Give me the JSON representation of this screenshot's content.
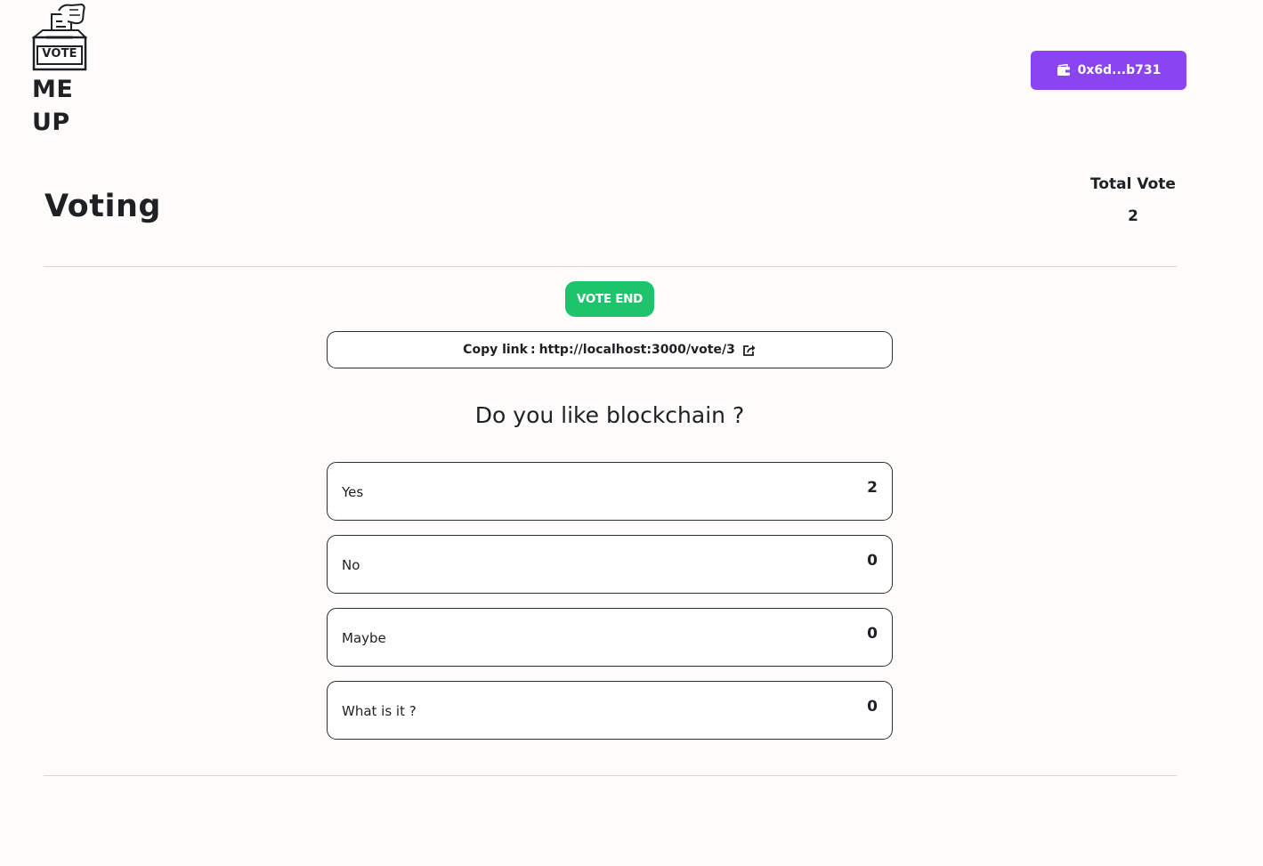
{
  "logo": {
    "box_text": "VOTE",
    "line1": "ME",
    "line2": "UP"
  },
  "wallet": {
    "address": "0x6d...b731",
    "icon": "wallet-icon",
    "color": "#8a44f2"
  },
  "page": {
    "title": "Voting"
  },
  "total": {
    "label": "Total Vote",
    "value": "2"
  },
  "status": {
    "label": "VOTE END",
    "color": "#1dc46b"
  },
  "copy_link": {
    "label": "Copy link",
    "separator": ":",
    "url": "http://localhost:3000/vote/3",
    "icon": "external-link-icon"
  },
  "question": "Do you like blockchain ?",
  "options": [
    {
      "label": "Yes",
      "count": "2"
    },
    {
      "label": "No",
      "count": "0"
    },
    {
      "label": "Maybe",
      "count": "0"
    },
    {
      "label": "What is it ?",
      "count": "0"
    }
  ]
}
